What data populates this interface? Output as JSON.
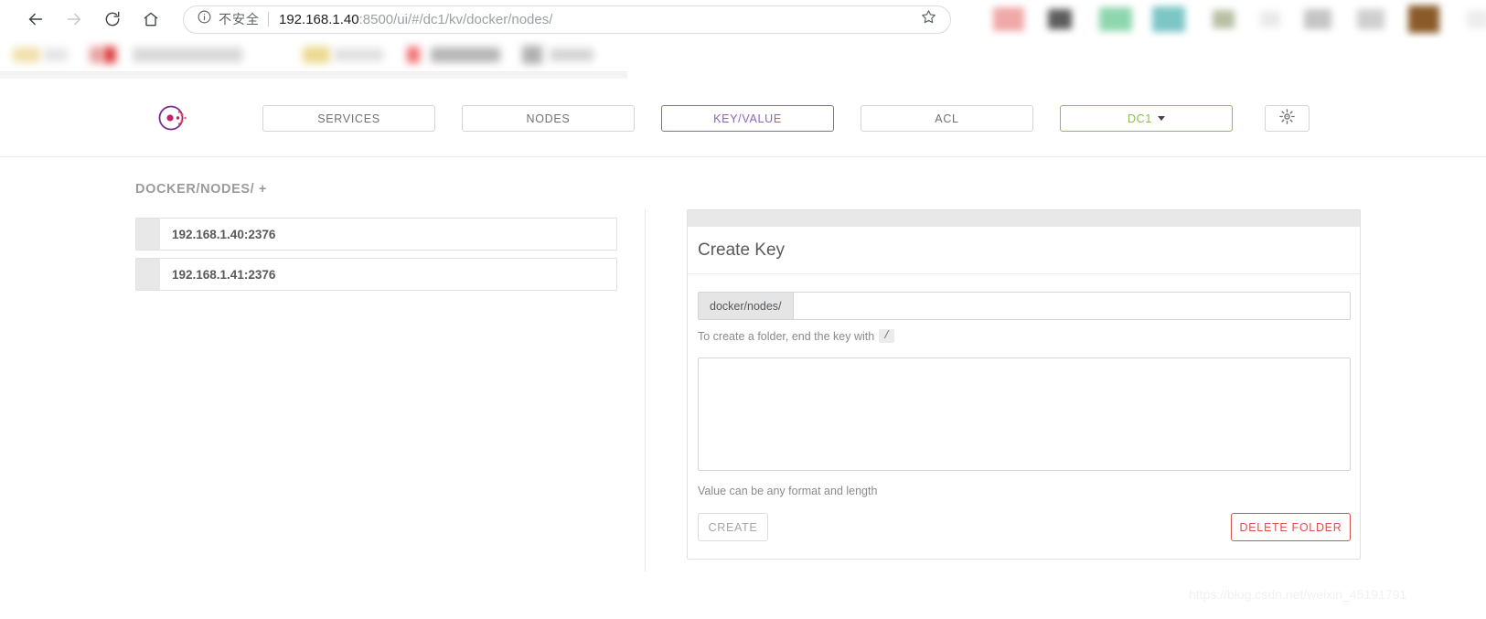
{
  "browser": {
    "back_icon": "arrow-left-icon",
    "forward_icon": "arrow-right-icon",
    "reload_icon": "reload-icon",
    "home_icon": "home-icon",
    "security_icon": "info-circle-icon",
    "security_label": "不安全",
    "url_host": "192.168.1.40",
    "url_rest": ":8500/ui/#/dc1/kv/docker/nodes/",
    "url_full": "192.168.1.40:8500/ui/#/dc1/kv/docker/nodes/",
    "bookmark_icon": "star-outline-icon"
  },
  "topnav": {
    "logo_name": "consul-logo",
    "tabs": [
      {
        "label": "SERVICES",
        "state": "default"
      },
      {
        "label": "NODES",
        "state": "default"
      },
      {
        "label": "KEY/VALUE",
        "state": "active"
      },
      {
        "label": "ACL",
        "state": "default"
      },
      {
        "label": "DC1",
        "state": "datacenter"
      }
    ],
    "settings_icon": "gear-icon"
  },
  "content": {
    "breadcrumb": "DOCKER/NODES/",
    "breadcrumb_add": "+",
    "kv_items": [
      {
        "label": "192.168.1.40:2376"
      },
      {
        "label": "192.168.1.41:2376"
      }
    ]
  },
  "panel": {
    "title": "Create Key",
    "key_prefix": "docker/nodes/",
    "key_value": "",
    "key_placeholder": "",
    "key_help_text": "To create a folder, end the key with",
    "key_help_badge": "/",
    "value_text": "",
    "value_placeholder": "",
    "value_help_text": "Value can be any format and length",
    "create_label": "CREATE",
    "delete_label": "DELETE FOLDER"
  },
  "watermark": {
    "text": "https://blog.csdn.net/weixin_45191791"
  },
  "colors": {
    "active_tab": "#8f63b5",
    "datacenter_tab": "#8bbd55",
    "delete": "#d9534f",
    "text_muted": "#8a8a8a"
  }
}
